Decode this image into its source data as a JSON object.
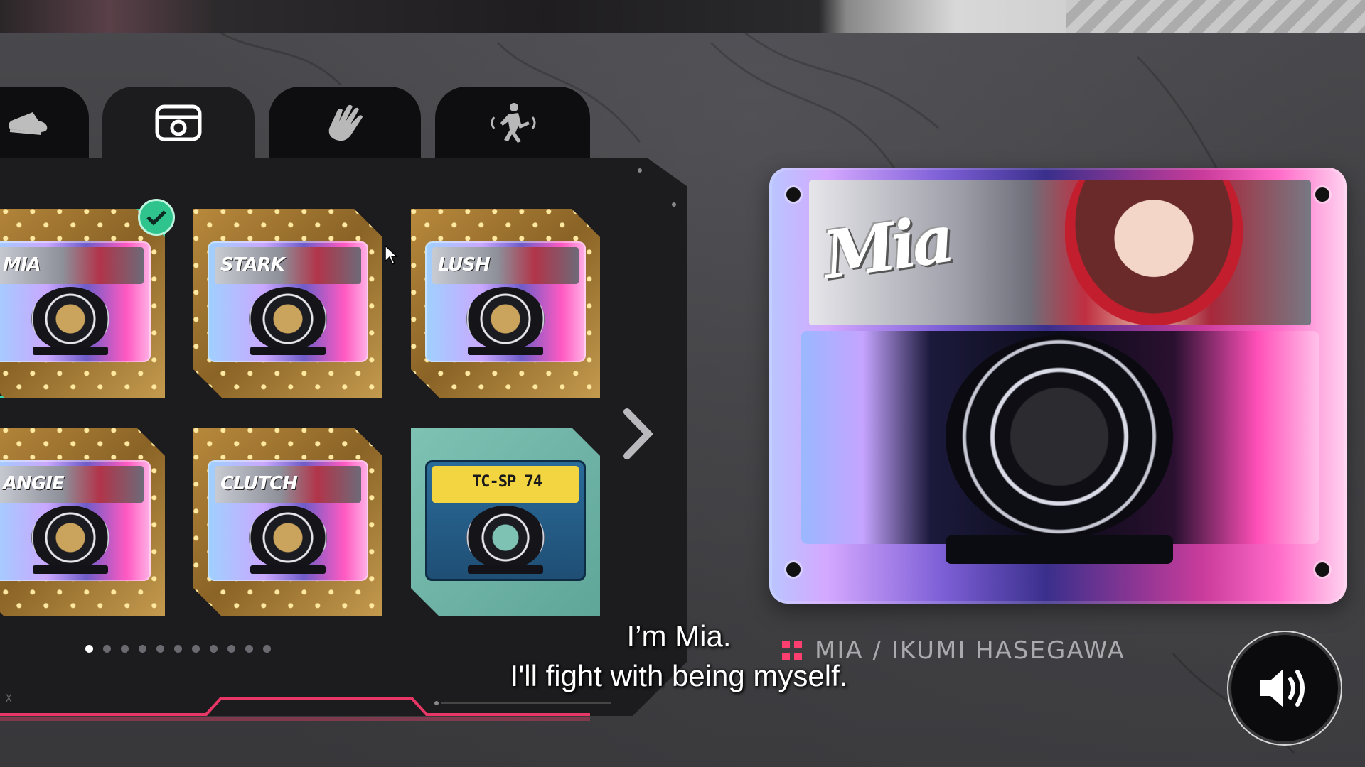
{
  "tabs": [
    {
      "id": "shoes",
      "icon": "sneaker-icon",
      "active": false
    },
    {
      "id": "cassette",
      "icon": "cassette-icon",
      "active": true
    },
    {
      "id": "gloves",
      "icon": "glove-icon",
      "active": false
    },
    {
      "id": "emote",
      "icon": "dancing-figure-icon",
      "active": false
    }
  ],
  "grid": {
    "cards": [
      {
        "label": "MIA",
        "selected": true
      },
      {
        "label": "STARK",
        "selected": false
      },
      {
        "label": "LUSH",
        "selected": false
      },
      {
        "label": "ANGIE",
        "selected": false
      },
      {
        "label": "CLUTCH",
        "selected": false
      },
      {
        "label": "TC-SP 74",
        "selected": false
      }
    ],
    "page_count": 11,
    "current_page": 1
  },
  "preview": {
    "graffiti": "Mia"
  },
  "credit": {
    "name": "MIA / IKUMI HASEGAWA",
    "accent": "#ff3f6f"
  },
  "subtitle": {
    "line1": "I’m Mia.",
    "line2": "I'll fight with being myself."
  },
  "corner_mark": "X",
  "colors": {
    "selection": "#2fc48e",
    "panel": "#1c1c1f"
  }
}
